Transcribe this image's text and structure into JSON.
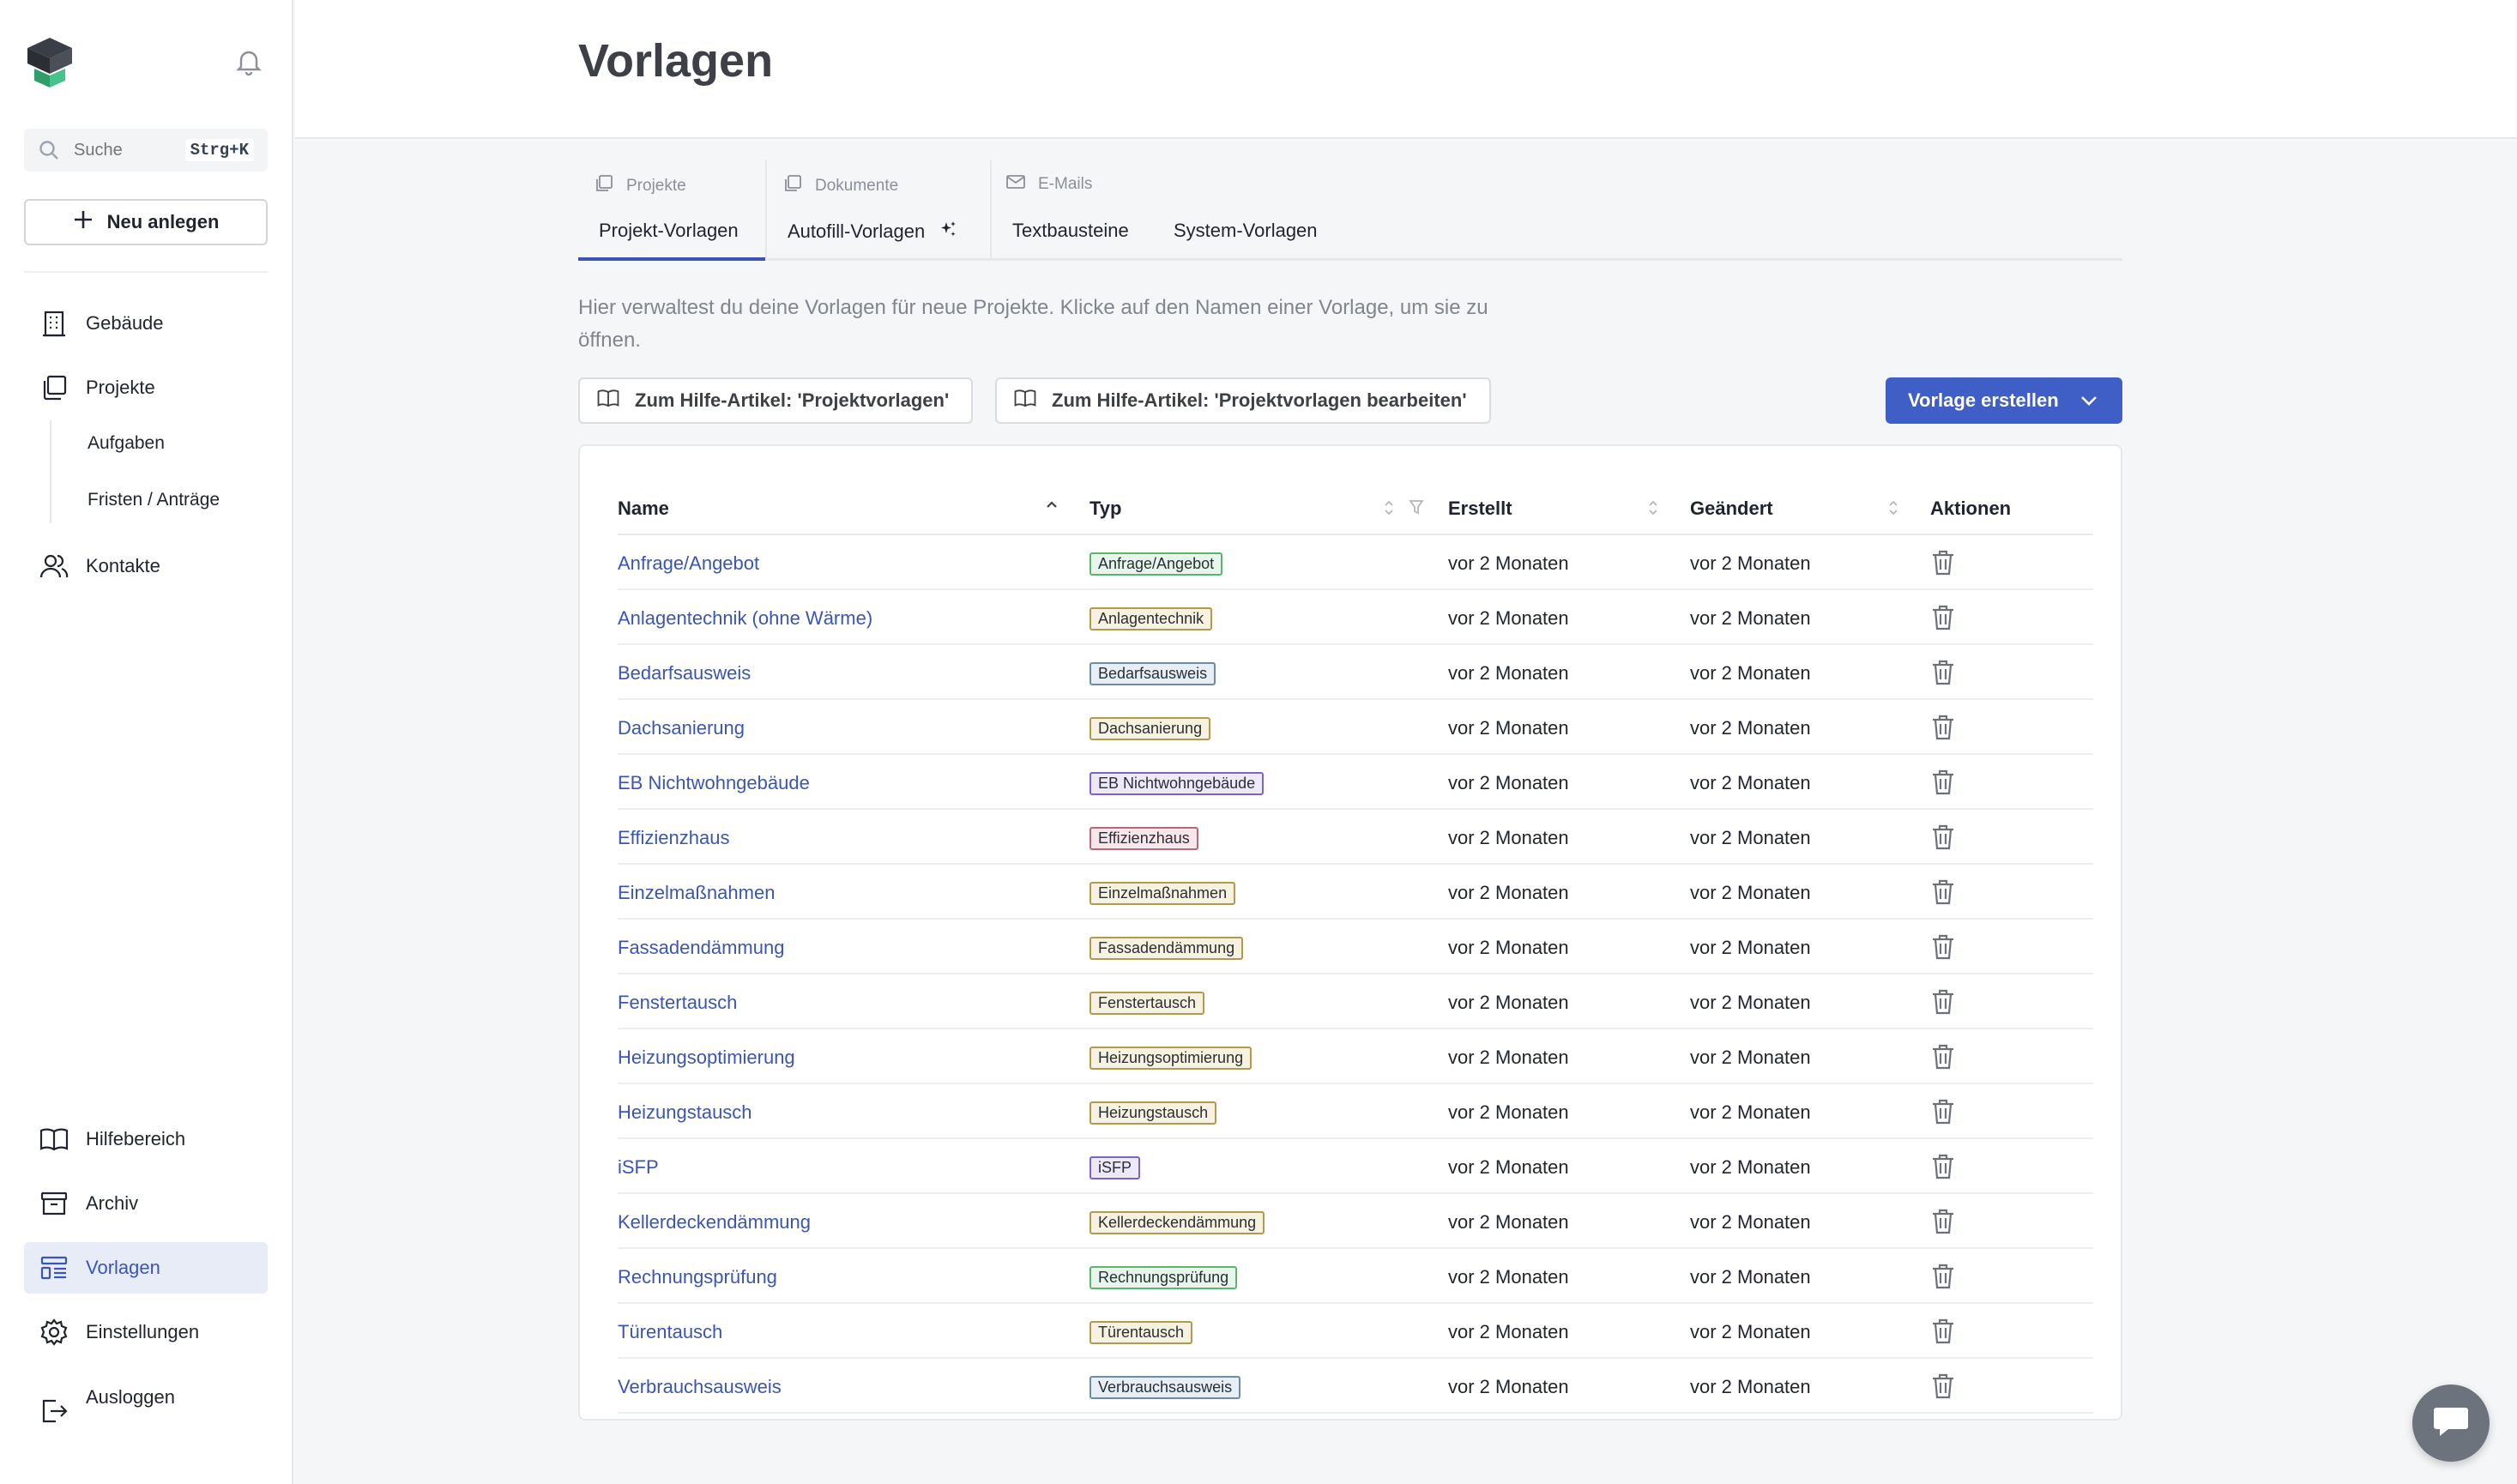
{
  "sidebar": {
    "search": {
      "placeholder": "Suche",
      "shortcut": "Strg+K"
    },
    "new_button": "Neu anlegen",
    "nav": {
      "buildings": "Gebäude",
      "projects": "Projekte",
      "tasks": "Aufgaben",
      "deadlines": "Fristen / Anträge",
      "contacts": "Kontakte",
      "help": "Hilfebereich",
      "archive": "Archiv",
      "templates": "Vorlagen",
      "settings": "Einstellungen",
      "logout": "Ausloggen"
    },
    "accent_color": "#3a55b8"
  },
  "header": {
    "title": "Vorlagen"
  },
  "tabs": {
    "groups": {
      "projects": "Projekte",
      "documents": "Dokumente",
      "emails": "E-Mails"
    },
    "project_templates": "Projekt-Vorlagen",
    "autofill_templates": "Autofill-Vorlagen",
    "text_blocks": "Textbausteine",
    "system_templates": "System-Vorlagen"
  },
  "description": "Hier verwaltest du deine Vorlagen für neue Projekte. Klicke auf den Namen einer Vorlage, um sie zu öffnen.",
  "buttons": {
    "help_article_1": "Zum Hilfe-Artikel: 'Projektvorlagen'",
    "help_article_2": "Zum Hilfe-Artikel: 'Projektvorlagen bearbeiten'",
    "create": "Vorlage erstellen"
  },
  "table": {
    "columns": {
      "name": "Name",
      "type": "Typ",
      "created": "Erstellt",
      "changed": "Geändert",
      "actions": "Aktionen"
    },
    "rows": [
      {
        "name": "Anfrage/Angebot",
        "type": "Anfrage/Angebot",
        "type_bg": "#e7f6ea",
        "type_border": "#5bb56a",
        "created": "vor 2 Monaten",
        "changed": "vor 2 Monaten"
      },
      {
        "name": "Anlagentechnik (ohne Wärme)",
        "type": "Anlagentechnik",
        "type_bg": "#f7f1df",
        "type_border": "#b39a4a",
        "created": "vor 2 Monaten",
        "changed": "vor 2 Monaten"
      },
      {
        "name": "Bedarfsausweis",
        "type": "Bedarfsausweis",
        "type_bg": "#e6eef6",
        "type_border": "#6f8aa6",
        "created": "vor 2 Monaten",
        "changed": "vor 2 Monaten"
      },
      {
        "name": "Dachsanierung",
        "type": "Dachsanierung",
        "type_bg": "#f7f1df",
        "type_border": "#b39a4a",
        "created": "vor 2 Monaten",
        "changed": "vor 2 Monaten"
      },
      {
        "name": "EB Nichtwohngebäude",
        "type": "EB Nichtwohngebäude",
        "type_bg": "#eee9fa",
        "type_border": "#7d62c9",
        "created": "vor 2 Monaten",
        "changed": "vor 2 Monaten"
      },
      {
        "name": "Effizienzhaus",
        "type": "Effizienzhaus",
        "type_bg": "#f8e6ea",
        "type_border": "#b8667a",
        "created": "vor 2 Monaten",
        "changed": "vor 2 Monaten"
      },
      {
        "name": "Einzelmaßnahmen",
        "type": "Einzelmaßnahmen",
        "type_bg": "#f7f1df",
        "type_border": "#b39a4a",
        "created": "vor 2 Monaten",
        "changed": "vor 2 Monaten"
      },
      {
        "name": "Fassadendämmung",
        "type": "Fassadendämmung",
        "type_bg": "#f7f1df",
        "type_border": "#b39a4a",
        "created": "vor 2 Monaten",
        "changed": "vor 2 Monaten"
      },
      {
        "name": "Fenstertausch",
        "type": "Fenstertausch",
        "type_bg": "#f7f1df",
        "type_border": "#b39a4a",
        "created": "vor 2 Monaten",
        "changed": "vor 2 Monaten"
      },
      {
        "name": "Heizungsoptimierung",
        "type": "Heizungsoptimierung",
        "type_bg": "#f7f1df",
        "type_border": "#b39a4a",
        "created": "vor 2 Monaten",
        "changed": "vor 2 Monaten"
      },
      {
        "name": "Heizungstausch",
        "type": "Heizungstausch",
        "type_bg": "#f7f1df",
        "type_border": "#b39a4a",
        "created": "vor 2 Monaten",
        "changed": "vor 2 Monaten"
      },
      {
        "name": "iSFP",
        "type": "iSFP",
        "type_bg": "#eee9fa",
        "type_border": "#7d62c9",
        "created": "vor 2 Monaten",
        "changed": "vor 2 Monaten"
      },
      {
        "name": "Kellerdeckendämmung",
        "type": "Kellerdeckendämmung",
        "type_bg": "#f7f1df",
        "type_border": "#b39a4a",
        "created": "vor 2 Monaten",
        "changed": "vor 2 Monaten"
      },
      {
        "name": "Rechnungsprüfung",
        "type": "Rechnungsprüfung",
        "type_bg": "#e7f6ea",
        "type_border": "#5bb56a",
        "created": "vor 2 Monaten",
        "changed": "vor 2 Monaten"
      },
      {
        "name": "Türentausch",
        "type": "Türentausch",
        "type_bg": "#f7f1df",
        "type_border": "#b39a4a",
        "created": "vor 2 Monaten",
        "changed": "vor 2 Monaten"
      },
      {
        "name": "Verbrauchsausweis",
        "type": "Verbrauchsausweis",
        "type_bg": "#e6eef6",
        "type_border": "#6f8aa6",
        "created": "vor 2 Monaten",
        "changed": "vor 2 Monaten"
      }
    ]
  },
  "icons": {
    "logo": "cube-logo-icon",
    "bell": "bell-icon",
    "search": "search-icon",
    "plus": "plus-icon",
    "trash": "trash-icon",
    "book": "book-icon",
    "chevron": "chevron-down-icon",
    "chat": "chat-icon"
  }
}
